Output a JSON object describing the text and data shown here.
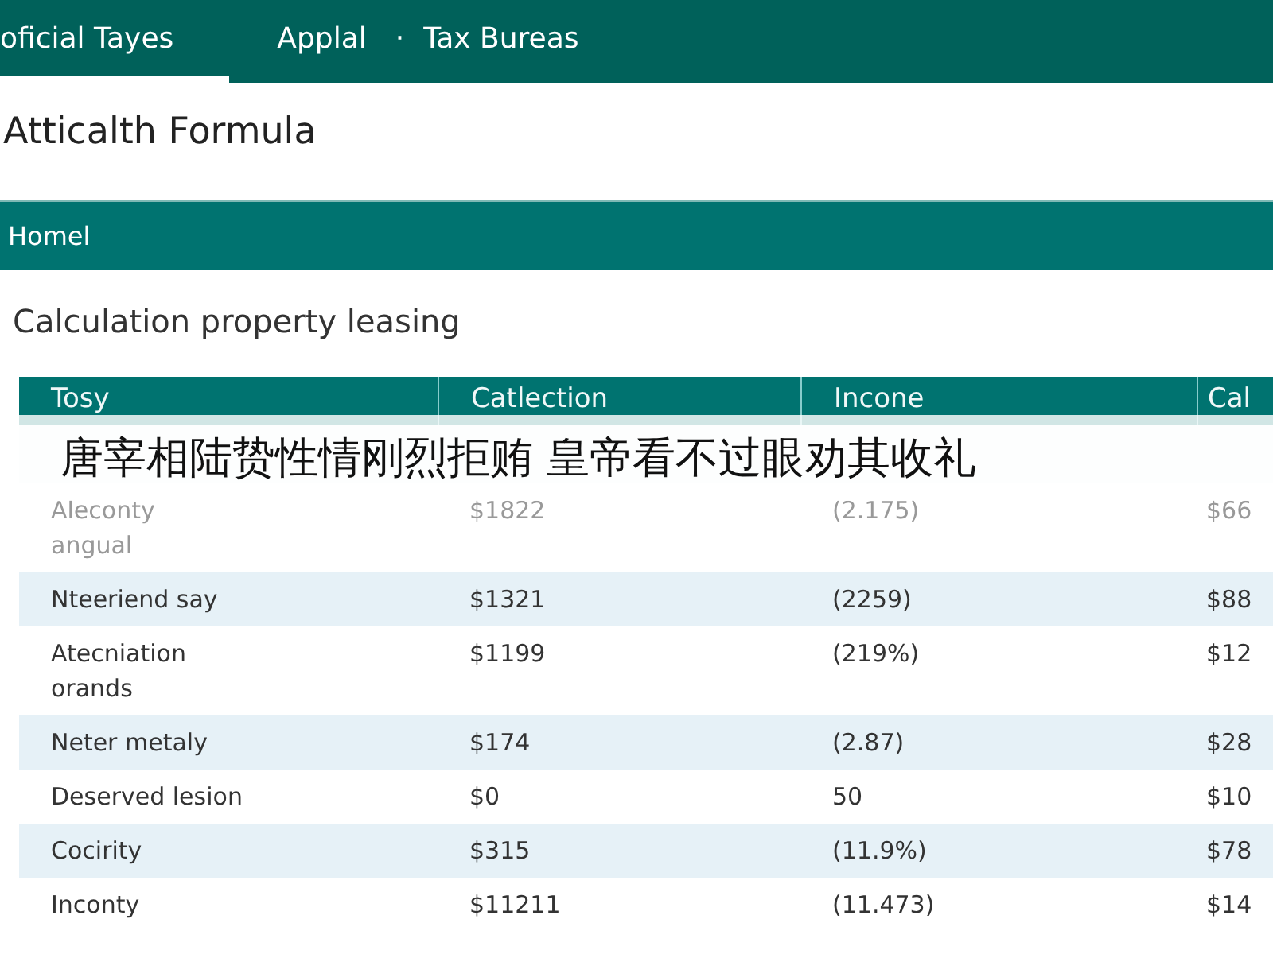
{
  "nav": {
    "tabs": [
      {
        "label": "oficial Tayes",
        "selected": true
      },
      {
        "label": "Applal",
        "selected": false
      }
    ],
    "separator": "·",
    "crumb": "Tax Bureas"
  },
  "page_title": "Atticalth Formula",
  "menu_bar": {
    "label": "Homel"
  },
  "section_title": "Calculation property leasing",
  "table": {
    "columns": [
      "Tosy",
      "Catlection",
      "Incone",
      "Cal"
    ],
    "rows": [
      {
        "cells": [
          "Aleconty\nangual",
          "$1822",
          "(2.175)",
          "$66"
        ],
        "faded": true
      },
      {
        "cells": [
          "Nteeriend say",
          "$1321",
          "(2259)",
          "$88"
        ],
        "faded": false
      },
      {
        "cells": [
          "Atecniation\norands",
          "$1199",
          "(219%)",
          "$12"
        ],
        "faded": false
      },
      {
        "cells": [
          "Neter metaly",
          "$174",
          "(2.87)",
          "$28"
        ],
        "faded": false
      },
      {
        "cells": [
          "Deserved lesion",
          "$0",
          "50",
          "$10"
        ],
        "faded": false
      },
      {
        "cells": [
          "Cocirity",
          "$315",
          "(11.9%)",
          "$78"
        ],
        "faded": false
      },
      {
        "cells": [
          "Inconty",
          "$11211",
          "(11.473)",
          "$14"
        ],
        "faded": false
      }
    ]
  },
  "caption": "唐宰相陆贽性情刚烈拒贿 皇帝看不过眼劝其收礼"
}
